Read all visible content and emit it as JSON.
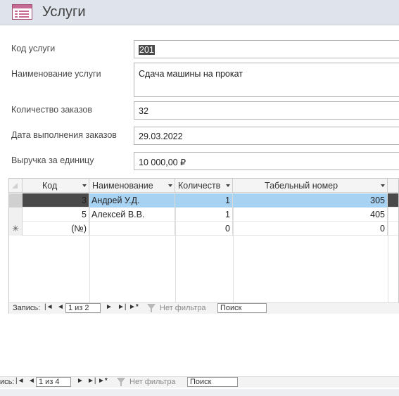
{
  "header": {
    "title": "Услуги",
    "icon": "form-icon"
  },
  "fields": {
    "code": {
      "label": "Код услуги",
      "value": "201"
    },
    "name": {
      "label": "Наименование услуги",
      "value": "Сдача машины на прокат"
    },
    "orders": {
      "label": "Количество заказов",
      "value": "32"
    },
    "date": {
      "label": "Дата выполнения заказов",
      "value": "29.03.2022"
    },
    "revenue": {
      "label": "Выручка за единицу",
      "value": "10 000,00 ₽"
    }
  },
  "subform": {
    "columns": [
      "Код",
      "Наименование",
      "Количеств",
      "Табельный номер"
    ],
    "rows": [
      {
        "selector": "",
        "code": "3",
        "name": "Андрей У.Д.",
        "qty": "1",
        "tab": "305"
      },
      {
        "selector": "",
        "code": "5",
        "name": "Алексей В.В.",
        "qty": "1",
        "tab": "405"
      },
      {
        "selector": "✳",
        "code": "(№)",
        "name": "",
        "qty": "0",
        "tab": "0"
      }
    ],
    "nav": {
      "record_label": "Запись:",
      "position": "1 из 2",
      "filter": "Нет фильтра",
      "search": "Поиск"
    }
  },
  "mainnav": {
    "record_label": "ись:",
    "position": "1 из 4",
    "filter": "Нет фильтра",
    "search": "Поиск"
  }
}
